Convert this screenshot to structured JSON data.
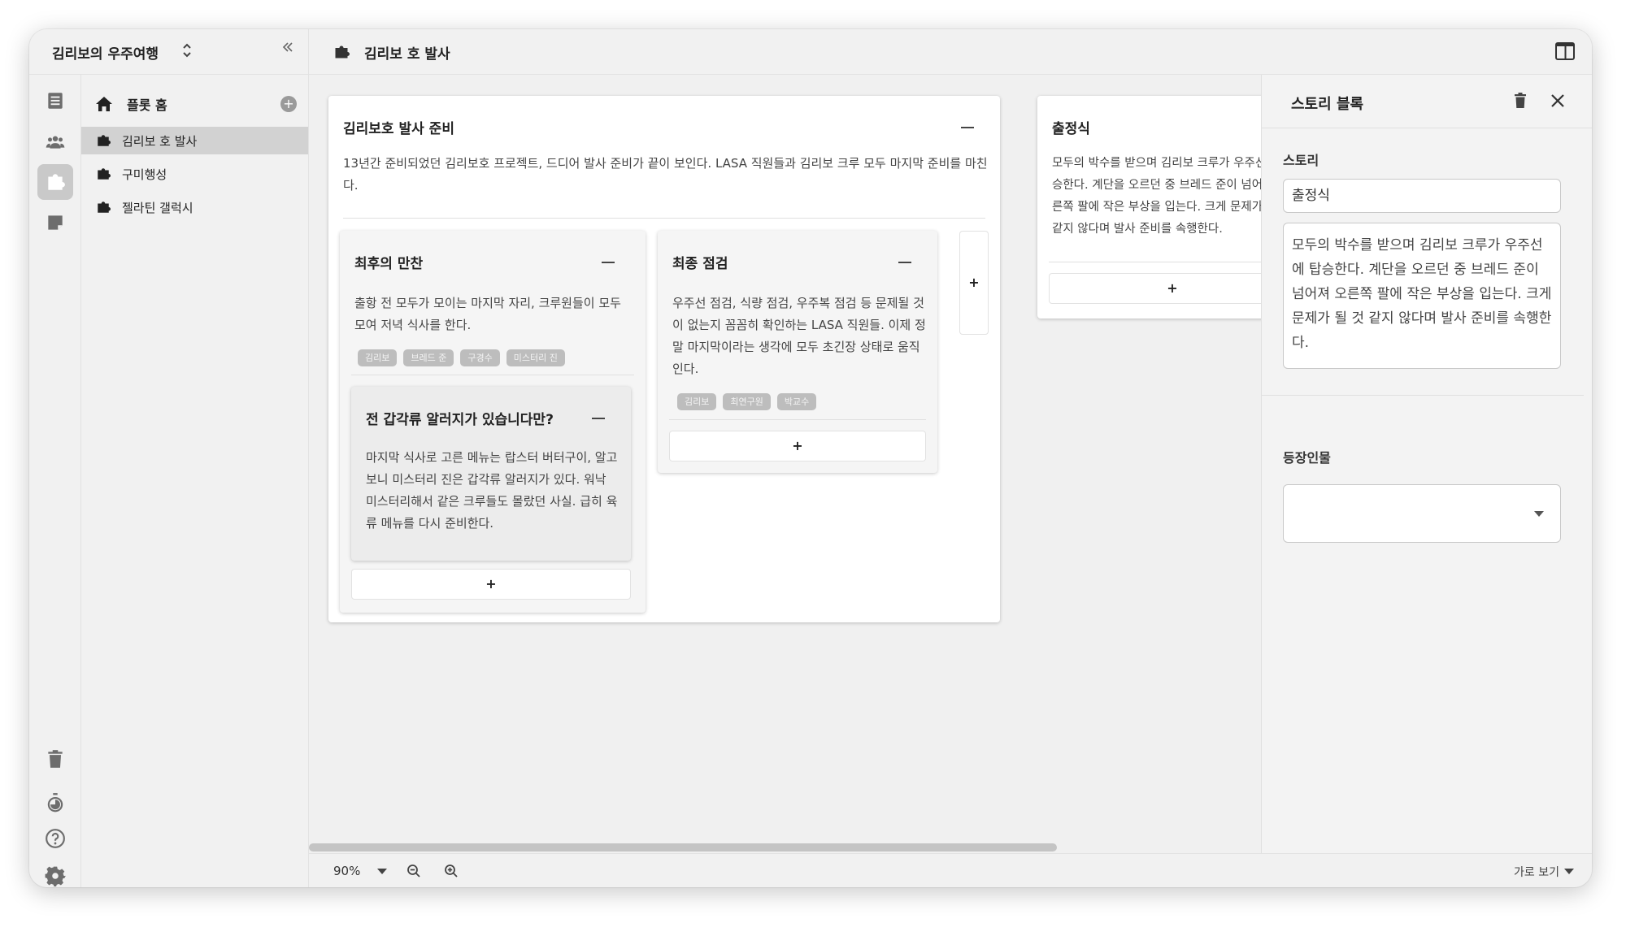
{
  "workspace": {
    "title": "김리보의 우주여행"
  },
  "sidebar": {
    "home_label": "플롯 홈",
    "items": [
      {
        "label": "김리보 호 발사"
      },
      {
        "label": "구미행성"
      },
      {
        "label": "젤라틴 갤럭시"
      }
    ]
  },
  "header": {
    "plot_title": "김리보 호 발사"
  },
  "board": {
    "card1": {
      "title": "김리보호 발사 준비",
      "body": "13년간 준비되었던 김리보호 프로젝트, 드디어 발사 준비가 끝이 보인다. LASA 직원들과 김리보 크루 모두 마지막 준비를 마친다."
    },
    "card1a": {
      "title": "최후의 만찬",
      "body": "출항 전 모두가 모이는 마지막 자리, 크루원들이 모두 모여 저녁 식사를 한다.",
      "tags": [
        "김리보",
        "브레드 준",
        "구경수",
        "미스터리 진"
      ]
    },
    "card1a1": {
      "title": "전 갑각류 알러지가 있습니다만?",
      "body": "마지막 식사로 고른 메뉴는 랍스터 버터구이, 알고보니 미스터리 진은 갑각류 알러지가 있다. 워낙 미스터리해서 같은 크루들도 몰랐던 사실. 급히 육류 메뉴를 다시 준비한다."
    },
    "card1b": {
      "title": "최종 점검",
      "body": "우주선 점검, 식량 점검, 우주복 점검 등 문제될 것이 없는지 꼼꼼히 확인하는 LASA 직원들. 이제 정말 마지막이라는 생각에 모두 초긴장 상태로 움직인다.",
      "tags": [
        "김리보",
        "최연구원",
        "박교수"
      ]
    },
    "card2": {
      "title": "출정식",
      "body": "모두의 박수를 받으며 김리보 크루가 우주선에 탑승한다. 계단을 오르던 중 브레드 준이 넘어져 오른쪽 팔에 작은 부상을 입는다. 크게 문제가 될 것 같지 않다며 발사 준비를 속행한다."
    },
    "add_label": "+"
  },
  "panel": {
    "title": "스토리 블록",
    "story_label": "스토리",
    "story_title": "출정식",
    "story_body": "모두의 박수를 받으며 김리보 크루가 우주선에 탑승한다. 계단을 오르던 중 브레드 준이 넘어져 오른쪽 팔에 작은 부상을 입는다. 크게 문제가 될 것 같지 않다며 발사 준비를 속행한다.",
    "characters_label": "등장인물"
  },
  "footer": {
    "zoom": "90%",
    "view_mode": "가로 보기"
  }
}
